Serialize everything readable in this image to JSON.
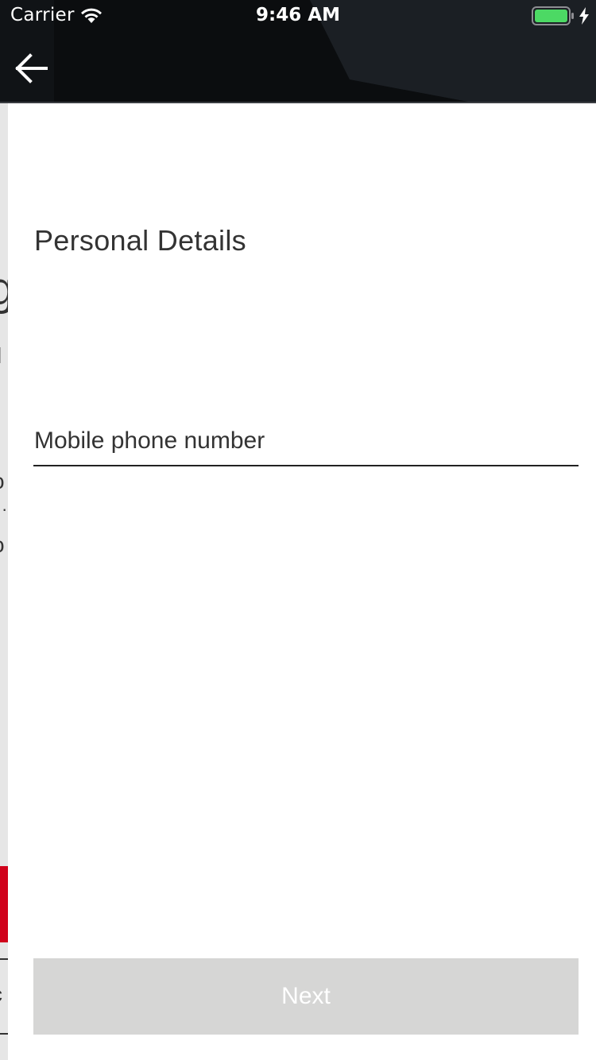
{
  "status_bar": {
    "carrier": "Carrier",
    "time": "9:46 AM",
    "wifi_icon": "wifi-icon",
    "battery_icon": "battery-full-icon",
    "charging_icon": "charging-bolt-icon",
    "battery_color": "#4cd964"
  },
  "nav": {
    "back_icon": "arrow-left-icon",
    "background_color": "#14171b"
  },
  "form": {
    "title": "Personal Details",
    "phone_field": {
      "placeholder": "Mobile phone number",
      "value": ""
    },
    "next_button": {
      "label": "Next",
      "enabled": false,
      "background_color": "#d6d6d5"
    }
  },
  "previous_screen_peek": {
    "accent_color": "#d0021b",
    "glyphs": [
      "g",
      "l",
      "o",
      "·",
      "o",
      "c"
    ]
  }
}
